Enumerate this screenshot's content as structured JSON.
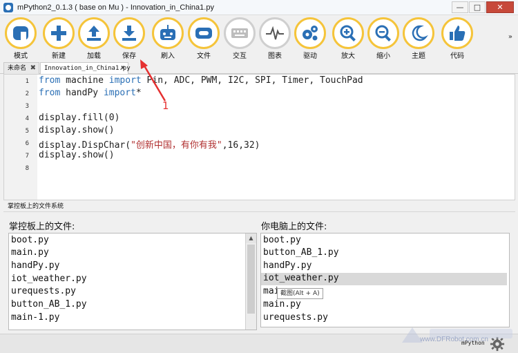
{
  "window": {
    "title": "mPython2_0.1.3 ( base on Mu ) - Innovation_in_China1.py",
    "controls": [
      "—",
      "□",
      "✕"
    ]
  },
  "toolbar": {
    "buttons": [
      {
        "label": "模式",
        "icon": "mode-icon"
      },
      {
        "label": "新建",
        "icon": "plus-icon"
      },
      {
        "label": "加载",
        "icon": "upload-icon"
      },
      {
        "label": "保存",
        "icon": "download-icon"
      },
      {
        "label": "刷入",
        "icon": "robot-icon"
      },
      {
        "label": "文件",
        "icon": "files-icon"
      },
      {
        "label": "交互",
        "icon": "keyboard-icon"
      },
      {
        "label": "图表",
        "icon": "pulse-icon"
      },
      {
        "label": "驱动",
        "icon": "gears-icon"
      },
      {
        "label": "放大",
        "icon": "zoom-in-icon"
      },
      {
        "label": "缩小",
        "icon": "zoom-out-icon"
      },
      {
        "label": "主题",
        "icon": "moon-icon"
      },
      {
        "label": "代码",
        "icon": "thumbs-up-icon"
      }
    ],
    "more": "»"
  },
  "tabs": [
    {
      "label": "未命名",
      "close": "✖"
    },
    {
      "label": "Innovation_in_China1.py",
      "close": "✖"
    }
  ],
  "editor": {
    "line_numbers": [
      "1",
      "2",
      "3",
      "4",
      "5",
      "6",
      "7",
      "8"
    ],
    "lines": [
      {
        "kw1": "from",
        "t1": " machine ",
        "kw2": "import",
        "t2": " Pin, ADC, PWM, I2C, SPI, Timer, TouchPad"
      },
      {
        "kw1": "from",
        "t1": " handPy ",
        "kw2": "import",
        "t2": "*"
      },
      {},
      {
        "text": "display.fill(0)"
      },
      {
        "text": "display.show()"
      },
      {
        "pre": "display.DispChar(",
        "str": "\"创新中国，有你有我\"",
        "post": ",16,32)"
      },
      {
        "text": "display.show()"
      },
      {}
    ]
  },
  "annotation": {
    "number": "1",
    "color": "#e53030"
  },
  "files_panel": {
    "header": "掌控板上的文件系统",
    "device_title": "掌控板上的文件:",
    "device_files": [
      "boot.py",
      "main.py",
      "handPy.py",
      "iot_weather.py",
      "urequests.py",
      "button_AB_1.py",
      "main-1.py"
    ],
    "pc_title": "你电脑上的文件:",
    "pc_files": [
      "boot.py",
      "button_AB_1.py",
      "handPy.py",
      "iot_weather.py",
      "mai",
      "main.py",
      "urequests.py"
    ],
    "pc_selected": "iot_weather.py",
    "tooltip": "截图(Alt + A)"
  },
  "statusbar": {
    "mode": "mPython",
    "watermark": "www.DFRobot.com.cn"
  },
  "colors": {
    "accent_yellow": "#f5c43a",
    "keyword_blue": "#2a6fb5",
    "string_red": "#b03030"
  }
}
